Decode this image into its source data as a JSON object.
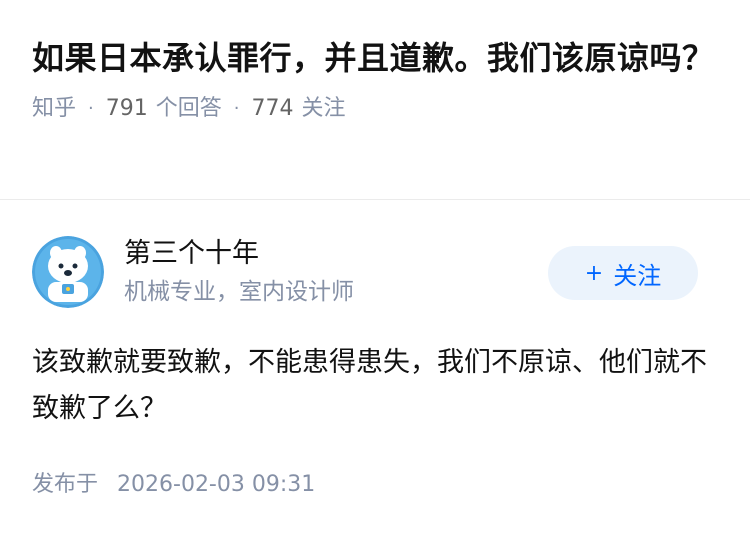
{
  "question": {
    "title": "如果日本承认罪行，并且道歉。我们该原谅吗？",
    "source": "知乎",
    "answer_count": "791",
    "answer_label": "个回答",
    "follower_count": "774",
    "follower_label": "关注"
  },
  "answer": {
    "author": {
      "name": "第三个十年",
      "bio": "机械专业，室内设计师",
      "avatar_icon": "cartoon-avatar-icon"
    },
    "follow_button": {
      "label": "关注",
      "icon": "plus-icon"
    },
    "content": "该致歉就要致歉，不能患得患失，我们不原谅、他们就不致歉了么？",
    "published_label": "发布于",
    "published_time": "2026-02-03 09:31"
  },
  "colors": {
    "accent": "#0066ff",
    "accent_bg": "#ebf3fc",
    "meta_text": "#8590a6",
    "primary_text": "#121212"
  }
}
